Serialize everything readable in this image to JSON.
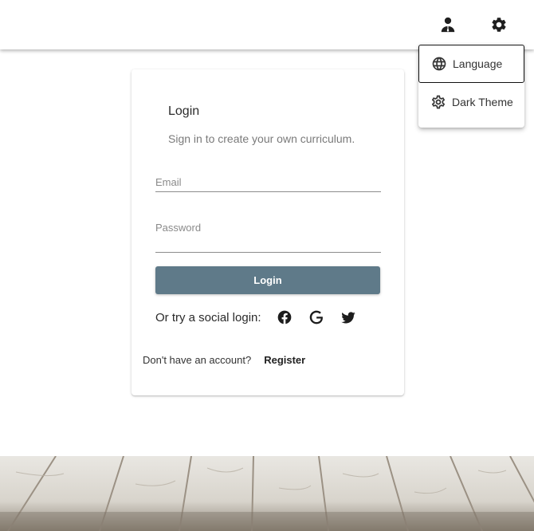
{
  "topbar": {
    "account_icon": "person-icon",
    "settings_icon": "gear-icon"
  },
  "settings_menu": {
    "items": [
      {
        "label": "Language",
        "icon": "globe-icon"
      },
      {
        "label": "Dark Theme",
        "icon": "gear-outline-icon"
      }
    ]
  },
  "login": {
    "title": "Login",
    "subtitle": "Sign in to create your own curriculum.",
    "email_placeholder": "Email",
    "password_placeholder": "Password",
    "login_button": "Login",
    "social_label": "Or try a social login:",
    "social_providers": [
      "facebook-icon",
      "google-icon",
      "twitter-icon"
    ],
    "no_account_text": "Don't have an account?",
    "register_link": "Register"
  },
  "colors": {
    "primary_button": "#5f7a89",
    "background": "#ffffff"
  }
}
